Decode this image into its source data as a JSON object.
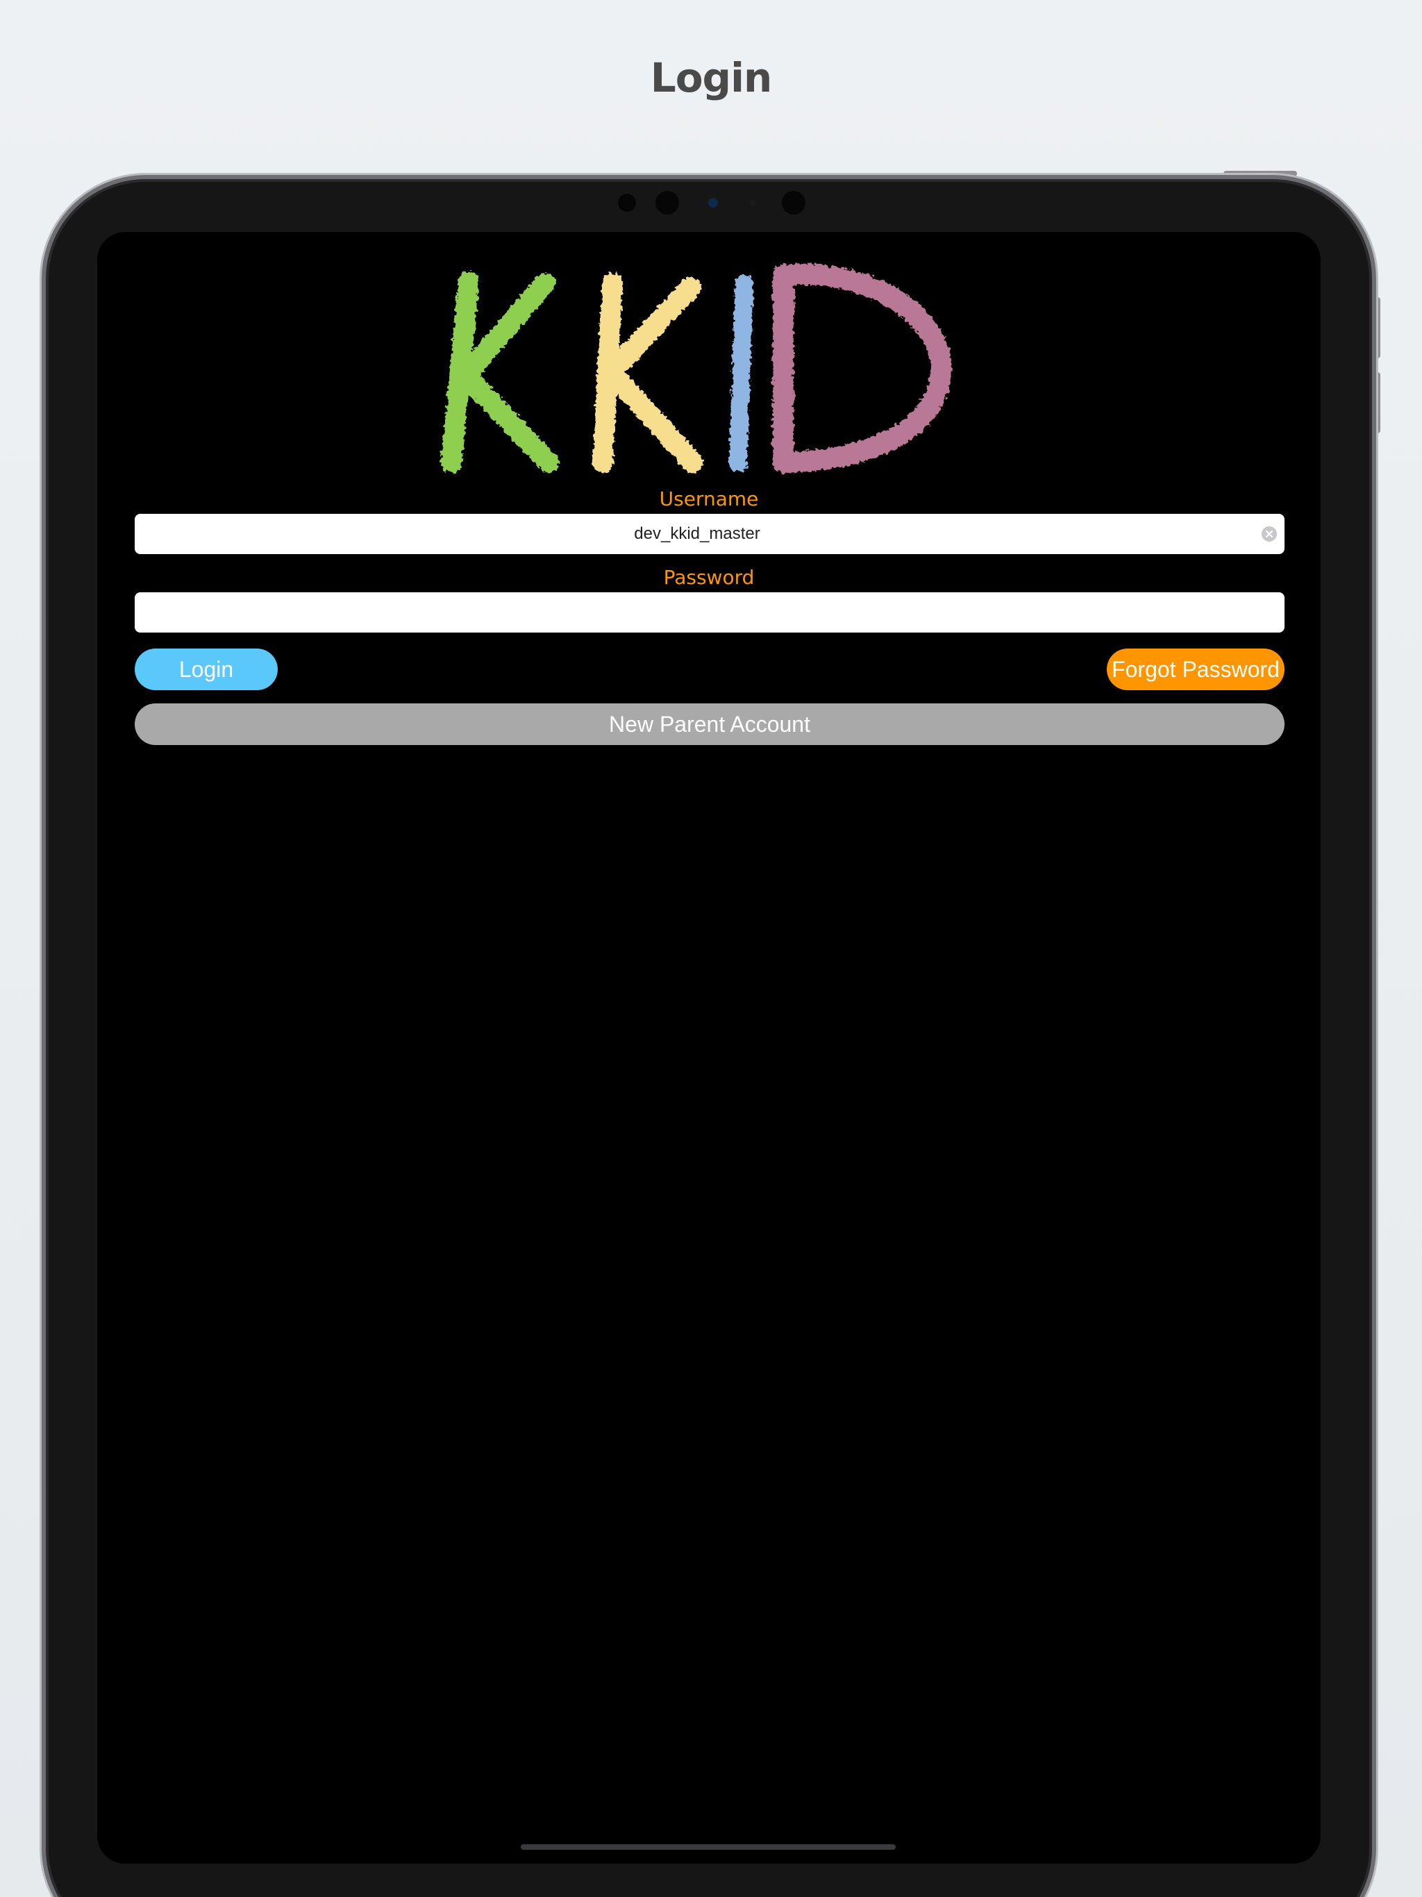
{
  "header": {
    "title": "Login"
  },
  "logo": {
    "text": "KKID",
    "letters": [
      {
        "char": "K",
        "color": "#8fcf4f"
      },
      {
        "char": "K",
        "color": "#f6de8e"
      },
      {
        "char": "I",
        "color": "#8fb6e3"
      },
      {
        "char": "D",
        "color": "#b87896"
      }
    ]
  },
  "form": {
    "username_label": "Username",
    "username_value": "dev_kkid_master",
    "password_label": "Password",
    "password_value": "",
    "login_button": "Login",
    "forgot_password_button": "Forgot Password",
    "new_parent_account_button": "New Parent Account"
  },
  "colors": {
    "accent_orange": "#ff9500",
    "login_blue": "#5ac8fa",
    "neutral_gray": "#a9a9a9",
    "screen_background": "#000000"
  },
  "icons": {
    "clear": "clear-circle-icon"
  }
}
